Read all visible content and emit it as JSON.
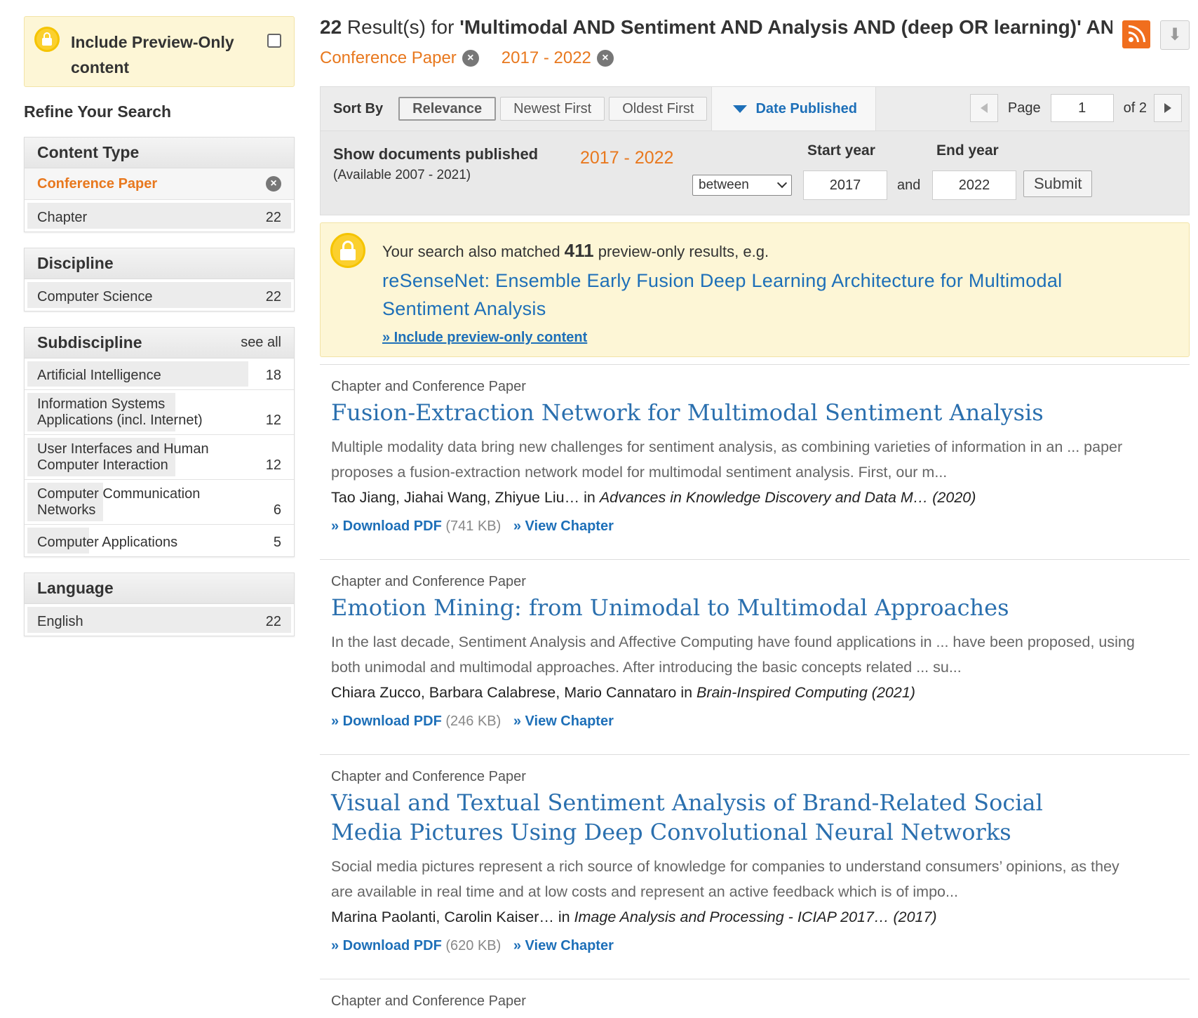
{
  "sidebar": {
    "preview_only_label": "Include Preview-Only content",
    "refine_title": "Refine Your Search",
    "content_type": {
      "title": "Content Type",
      "active": "Conference Paper",
      "items": [
        {
          "label": "Chapter",
          "count": "22"
        }
      ]
    },
    "discipline": {
      "title": "Discipline",
      "items": [
        {
          "label": "Computer Science",
          "count": "22"
        }
      ]
    },
    "subdiscipline": {
      "title": "Subdiscipline",
      "see_all": "see all",
      "items": [
        {
          "label": "Artificial Intelligence",
          "count": "18",
          "fill": 0.82
        },
        {
          "label": "Information Systems Applications (incl. Internet)",
          "count": "12",
          "fill": 0.55
        },
        {
          "label": "User Interfaces and Human Computer Interaction",
          "count": "12",
          "fill": 0.55
        },
        {
          "label": "Computer Communication Networks",
          "count": "6",
          "fill": 0.28
        },
        {
          "label": "Computer Applications",
          "count": "5",
          "fill": 0.23
        }
      ]
    },
    "language": {
      "title": "Language",
      "items": [
        {
          "label": "English",
          "count": "22"
        }
      ]
    }
  },
  "header": {
    "count": "22",
    "results_text": " Result(s) for ",
    "query": "'Multimodal AND Sentiment AND Analysis AND (deep OR learning)' AND chi",
    "chips": [
      "Conference Paper",
      "2017 - 2022"
    ]
  },
  "sort": {
    "label": "Sort By",
    "options": [
      "Relevance",
      "Newest First",
      "Oldest First"
    ],
    "date_tab": "Date Published",
    "page_label": "Page",
    "page_value": "1",
    "of_pages": "of 2"
  },
  "date_filter": {
    "title": "Show documents published",
    "available": "(Available 2007 - 2021)",
    "range": "2017 - 2022",
    "mode": "between",
    "start_label": "Start year",
    "end_label": "End year",
    "start_value": "2017",
    "and": "and",
    "end_value": "2022",
    "submit": "Submit"
  },
  "matched": {
    "prefix": "Your search also matched ",
    "count": "411",
    "suffix": " preview-only results, e.g.",
    "example_title": "reSenseNet: Ensemble Early Fusion Deep Learning Architecture for Multimodal Sentiment Analysis",
    "include_link": "» Include preview-only content"
  },
  "results": [
    {
      "type": "Chapter and Conference Paper",
      "title": "Fusion-Extraction Network for Multimodal Sentiment Analysis",
      "snippet": "Multiple modality data bring new challenges for sentiment analysis, as combining varieties of information in an ... paper proposes a fusion-extraction network model for multimodal sentiment analysis. First, our m...",
      "authors": "Tao Jiang, Jiahai Wang, Zhiyue Liu… in ",
      "source": "Advances in Knowledge Discovery and Data M… (2020)",
      "download": "» Download PDF",
      "size": "(741 KB)",
      "view": "» View Chapter"
    },
    {
      "type": "Chapter and Conference Paper",
      "title": "Emotion Mining: from Unimodal to Multimodal Approaches",
      "snippet": "In the last decade, Sentiment Analysis and Affective Computing have found applications in ... have been proposed, using both unimodal and multimodal approaches. After introducing the basic concepts related ... su...",
      "authors": "Chiara Zucco, Barbara Calabrese, Mario Cannataro in ",
      "source": "Brain-Inspired Computing (2021)",
      "download": "» Download PDF",
      "size": "(246 KB)",
      "view": "» View Chapter"
    },
    {
      "type": "Chapter and Conference Paper",
      "title": "Visual and Textual Sentiment Analysis of Brand-Related Social Media Pictures Using Deep Convolutional Neural Networks",
      "snippet": "Social media pictures represent a rich source of knowledge for companies to understand consumers’ opinions, as they are available in real time and at low costs and represent an active feedback which is of impo...",
      "authors": "Marina Paolanti, Carolin Kaiser… in ",
      "source": "Image Analysis and Processing - ICIAP 2017… (2017)",
      "download": "» Download PDF",
      "size": "(620 KB)",
      "view": "» View Chapter"
    }
  ],
  "colors": {
    "accent_orange": "#e8781e",
    "link_blue": "#1d6fb8",
    "preview_bg": "#fdf6d6"
  },
  "icons": [
    "lock-icon",
    "checkbox",
    "remove-icon",
    "rss-icon",
    "download-icon",
    "caret-down-icon",
    "prev-page-icon",
    "next-page-icon"
  ]
}
